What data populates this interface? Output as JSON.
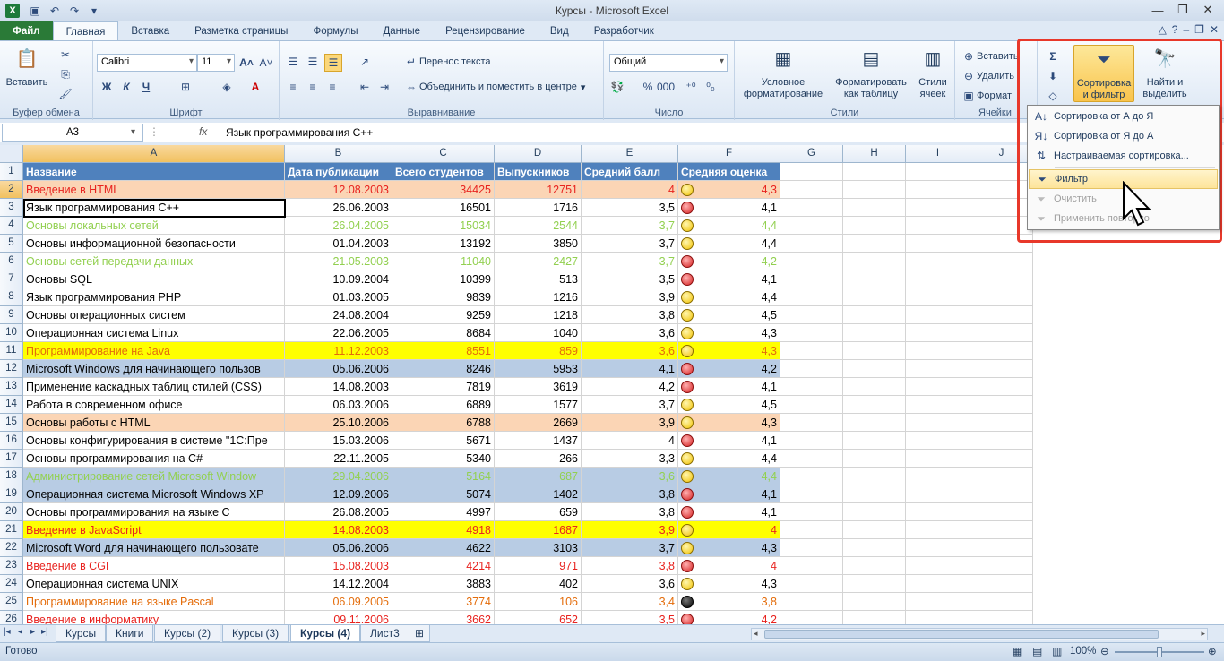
{
  "window": {
    "title": "Курсы  -  Microsoft Excel"
  },
  "icons": {
    "excel": "excel-logo",
    "save": "save-icon",
    "undo": "undo-icon",
    "redo": "redo-icon"
  },
  "tabs": [
    "Файл",
    "Главная",
    "Вставка",
    "Разметка страницы",
    "Формулы",
    "Данные",
    "Рецензирование",
    "Вид",
    "Разработчик"
  ],
  "ribbon": {
    "clipboard": {
      "paste": "Вставить",
      "label": "Буфер обмена"
    },
    "font": {
      "name": "Calibri",
      "size": "11",
      "label": "Шрифт"
    },
    "alignment": {
      "wrap": "Перенос текста",
      "merge": "Объединить и поместить в центре",
      "label": "Выравнивание"
    },
    "number": {
      "format": "Общий",
      "label": "Число"
    },
    "styles": {
      "conditional": "Условное форматирование",
      "as_table": "Форматировать как таблицу",
      "cell_styles": "Стили ячеек",
      "label": "Стили"
    },
    "cells": {
      "insert": "Вставить",
      "delete": "Удалить",
      "format": "Формат",
      "label": "Ячейки"
    },
    "editing": {
      "sort_filter": "Сортировка и фильтр",
      "find": "Найти и выделить"
    }
  },
  "formula_bar": {
    "name_box": "A3",
    "fx": "fx",
    "formula": "Язык программирования С++"
  },
  "columns": [
    "A",
    "B",
    "C",
    "D",
    "E",
    "F",
    "G",
    "H",
    "I",
    "J"
  ],
  "headers": [
    "Название",
    "Дата публикации",
    "Всего студентов",
    "Выпускников",
    "Средний балл",
    "Средняя оценка"
  ],
  "rows": [
    {
      "n": "2",
      "name": "Введение в HTML",
      "date": "12.08.2003",
      "students": "34425",
      "grads": "12751",
      "avg": "4",
      "dot": "yellow",
      "grade": "4,3",
      "bg": "#fbd5b5",
      "color": "#e8231f"
    },
    {
      "n": "3",
      "name": "Язык программирования С++",
      "date": "26.06.2003",
      "students": "16501",
      "grads": "1716",
      "avg": "3,5",
      "dot": "red",
      "grade": "4,1",
      "bg": "#ffffff",
      "color": "#000000"
    },
    {
      "n": "4",
      "name": "Основы локальных сетей",
      "date": "26.04.2005",
      "students": "15034",
      "grads": "2544",
      "avg": "3,7",
      "dot": "yellow",
      "grade": "4,4",
      "bg": "#ffffff",
      "color": "#92d050"
    },
    {
      "n": "5",
      "name": "Основы информационной безопасности",
      "date": "01.04.2003",
      "students": "13192",
      "grads": "3850",
      "avg": "3,7",
      "dot": "yellow",
      "grade": "4,4",
      "bg": "#ffffff",
      "color": "#000000"
    },
    {
      "n": "6",
      "name": "Основы сетей передачи данных",
      "date": "21.05.2003",
      "students": "11040",
      "grads": "2427",
      "avg": "3,7",
      "dot": "red",
      "grade": "4,2",
      "bg": "#ffffff",
      "color": "#92d050"
    },
    {
      "n": "7",
      "name": "Основы SQL",
      "date": "10.09.2004",
      "students": "10399",
      "grads": "513",
      "avg": "3,5",
      "dot": "red",
      "grade": "4,1",
      "bg": "#ffffff",
      "color": "#000000"
    },
    {
      "n": "8",
      "name": "Язык программирования PHP",
      "date": "01.03.2005",
      "students": "9839",
      "grads": "1216",
      "avg": "3,9",
      "dot": "yellow",
      "grade": "4,4",
      "bg": "#ffffff",
      "color": "#000000"
    },
    {
      "n": "9",
      "name": "Основы операционных систем",
      "date": "24.08.2004",
      "students": "9259",
      "grads": "1218",
      "avg": "3,8",
      "dot": "yellow",
      "grade": "4,5",
      "bg": "#ffffff",
      "color": "#000000"
    },
    {
      "n": "10",
      "name": "Операционная система Linux",
      "date": "22.06.2005",
      "students": "8684",
      "grads": "1040",
      "avg": "3,6",
      "dot": "yellow",
      "grade": "4,3",
      "bg": "#ffffff",
      "color": "#000000"
    },
    {
      "n": "11",
      "name": "Программирование на Java",
      "date": "11.12.2003",
      "students": "8551",
      "grads": "859",
      "avg": "3,6",
      "dot": "yellow",
      "grade": "4,3",
      "bg": "#ffff00",
      "color": "#e46c0a"
    },
    {
      "n": "12",
      "name": "Microsoft Windows для начинающего пользов",
      "date": "05.06.2006",
      "students": "8246",
      "grads": "5953",
      "avg": "4,1",
      "dot": "red",
      "grade": "4,2",
      "bg": "#b8cce4",
      "color": "#000000"
    },
    {
      "n": "13",
      "name": "Применение каскадных таблиц стилей (CSS)",
      "date": "14.08.2003",
      "students": "7819",
      "grads": "3619",
      "avg": "4,2",
      "dot": "red",
      "grade": "4,1",
      "bg": "#ffffff",
      "color": "#000000"
    },
    {
      "n": "14",
      "name": "Работа в современном офисе",
      "date": "06.03.2006",
      "students": "6889",
      "grads": "1577",
      "avg": "3,7",
      "dot": "yellow",
      "grade": "4,5",
      "bg": "#ffffff",
      "color": "#000000"
    },
    {
      "n": "15",
      "name": "Основы работы с HTML",
      "date": "25.10.2006",
      "students": "6788",
      "grads": "2669",
      "avg": "3,9",
      "dot": "yellow",
      "grade": "4,3",
      "bg": "#fbd5b5",
      "color": "#000000"
    },
    {
      "n": "16",
      "name": "Основы конфигурирования в системе \"1С:Пре",
      "date": "15.03.2006",
      "students": "5671",
      "grads": "1437",
      "avg": "4",
      "dot": "red",
      "grade": "4,1",
      "bg": "#ffffff",
      "color": "#000000"
    },
    {
      "n": "17",
      "name": "Основы программирования на C#",
      "date": "22.11.2005",
      "students": "5340",
      "grads": "266",
      "avg": "3,3",
      "dot": "yellow",
      "grade": "4,4",
      "bg": "#ffffff",
      "color": "#000000"
    },
    {
      "n": "18",
      "name": "Администрирование сетей Microsoft Window",
      "date": "29.04.2006",
      "students": "5164",
      "grads": "687",
      "avg": "3,6",
      "dot": "yellow",
      "grade": "4,4",
      "bg": "#b8cce4",
      "color": "#92d050"
    },
    {
      "n": "19",
      "name": "Операционная система Microsoft Windows XP",
      "date": "12.09.2006",
      "students": "5074",
      "grads": "1402",
      "avg": "3,8",
      "dot": "red",
      "grade": "4,1",
      "bg": "#b8cce4",
      "color": "#000000"
    },
    {
      "n": "20",
      "name": "Основы программирования на языке С",
      "date": "26.08.2005",
      "students": "4997",
      "grads": "659",
      "avg": "3,8",
      "dot": "red",
      "grade": "4,1",
      "bg": "#ffffff",
      "color": "#000000"
    },
    {
      "n": "21",
      "name": "Введение в JavaScript",
      "date": "14.08.2003",
      "students": "4918",
      "grads": "1687",
      "avg": "3,9",
      "dot": "yellow",
      "grade": "4",
      "bg": "#ffff00",
      "color": "#e8231f"
    },
    {
      "n": "22",
      "name": "Microsoft Word для начинающего пользовате",
      "date": "05.06.2006",
      "students": "4622",
      "grads": "3103",
      "avg": "3,7",
      "dot": "yellow",
      "grade": "4,3",
      "bg": "#b8cce4",
      "color": "#000000"
    },
    {
      "n": "23",
      "name": "Введение в CGI",
      "date": "15.08.2003",
      "students": "4214",
      "grads": "971",
      "avg": "3,8",
      "dot": "red",
      "grade": "4",
      "bg": "#ffffff",
      "color": "#e8231f"
    },
    {
      "n": "24",
      "name": "Операционная система UNIX",
      "date": "14.12.2004",
      "students": "3883",
      "grads": "402",
      "avg": "3,6",
      "dot": "yellow",
      "grade": "4,3",
      "bg": "#ffffff",
      "color": "#000000"
    },
    {
      "n": "25",
      "name": "Программирование на языке Pascal",
      "date": "06.09.2005",
      "students": "3774",
      "grads": "106",
      "avg": "3,4",
      "dot": "black",
      "grade": "3,8",
      "bg": "#ffffff",
      "color": "#e46c0a"
    },
    {
      "n": "26",
      "name": "Введение в информатику",
      "date": "09.11.2006",
      "students": "3662",
      "grads": "652",
      "avg": "3,5",
      "dot": "red",
      "grade": "4,2",
      "bg": "#ffffff",
      "color": "#e8231f"
    }
  ],
  "menu": {
    "items": [
      {
        "label": "Сортировка от А до Я",
        "icon": "sort-asc-icon",
        "state": "normal"
      },
      {
        "label": "Сортировка от Я до А",
        "icon": "sort-desc-icon",
        "state": "normal"
      },
      {
        "label": "Настраиваемая сортировка...",
        "icon": "custom-sort-icon",
        "state": "normal"
      },
      {
        "label": "Фильтр",
        "icon": "filter-icon",
        "state": "highlighted"
      },
      {
        "label": "Очистить",
        "icon": "clear-filter-icon",
        "state": "disabled"
      },
      {
        "label": "Применить повторно",
        "icon": "reapply-filter-icon",
        "state": "disabled"
      }
    ]
  },
  "sheets": [
    "Курсы",
    "Книги",
    "Курсы (2)",
    "Курсы (3)",
    "Курсы (4)",
    "Лист3"
  ],
  "active_sheet": "Курсы (4)",
  "status": {
    "ready": "Готово",
    "zoom": "100%"
  }
}
